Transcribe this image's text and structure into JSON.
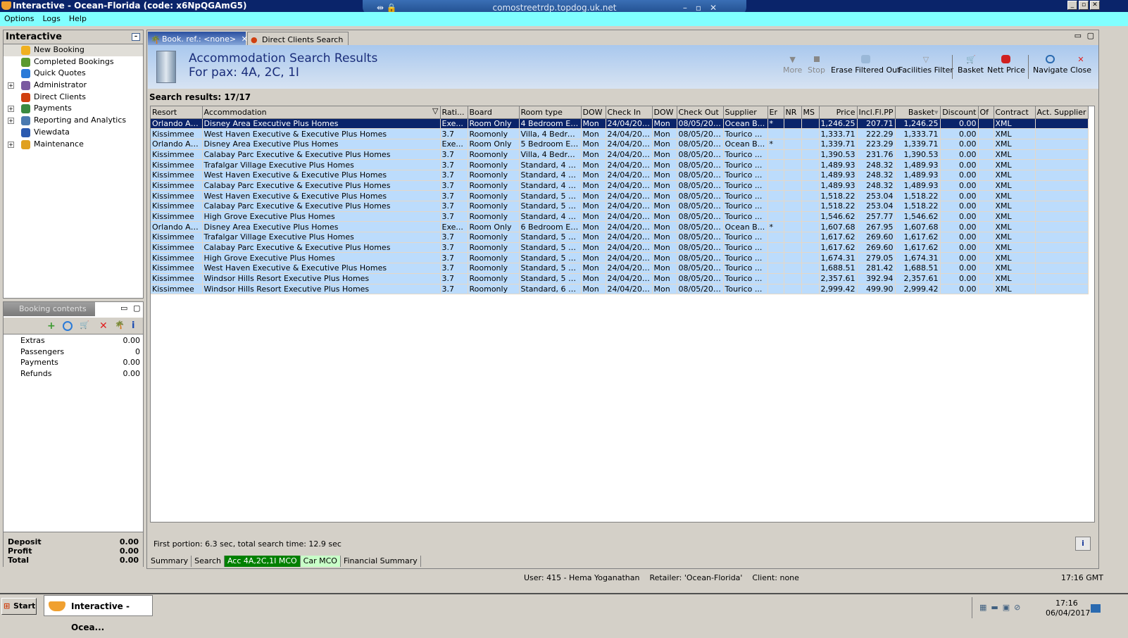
{
  "window": {
    "title": "Interactive - Ocean-Florida (code: x6NpQGAmG5)",
    "rdp_host": "comostreetrdp.topdog.uk.net"
  },
  "menu": [
    "Options",
    "Logs",
    "Help"
  ],
  "sidebar": {
    "title": "Interactive",
    "items": [
      {
        "label": "New Booking",
        "expandable": false,
        "icon": "palm-tree-icon"
      },
      {
        "label": "Completed Bookings",
        "expandable": false,
        "icon": "palm-money-icon"
      },
      {
        "label": "Quick Quotes",
        "expandable": false,
        "icon": "clock-icon"
      },
      {
        "label": "Administrator",
        "expandable": true,
        "icon": "admin-icon"
      },
      {
        "label": "Direct Clients",
        "expandable": false,
        "icon": "client-icon"
      },
      {
        "label": "Payments",
        "expandable": true,
        "icon": "payments-icon"
      },
      {
        "label": "Reporting and Analytics",
        "expandable": true,
        "icon": "report-icon"
      },
      {
        "label": "Viewdata",
        "expandable": false,
        "icon": "globe-icon"
      },
      {
        "label": "Maintenance",
        "expandable": true,
        "icon": "maintenance-icon"
      }
    ]
  },
  "booking_contents": {
    "tab": "Booking contents",
    "rows": [
      {
        "k": "Extras",
        "v": "0.00"
      },
      {
        "k": "Passengers",
        "v": "0"
      },
      {
        "k": "Payments",
        "v": "0.00"
      },
      {
        "k": "Refunds",
        "v": "0.00"
      }
    ],
    "totals": [
      {
        "k": "Deposit",
        "v": "0.00"
      },
      {
        "k": "Profit",
        "v": "0.00"
      },
      {
        "k": "Total",
        "v": "0.00"
      }
    ]
  },
  "tabs": [
    {
      "label": "Book. ref.: <none>",
      "active": true
    },
    {
      "label": "Direct Clients Search",
      "active": false
    }
  ],
  "header": {
    "title": "Accommodation Search Results",
    "subtitle": "For pax: 4A, 2C, 1I"
  },
  "toolbar": [
    {
      "label": "More",
      "enabled": false
    },
    {
      "label": "Stop",
      "enabled": false
    },
    {
      "label": "Erase Filtered Out",
      "enabled": true
    },
    {
      "label": "Facilities Filter",
      "enabled": true
    },
    {
      "label": "Basket",
      "enabled": true
    },
    {
      "label": "Nett Price",
      "enabled": true
    },
    {
      "label": "Navigate",
      "enabled": true
    },
    {
      "label": "Close",
      "enabled": true
    }
  ],
  "search_results": "Search results: 17/17",
  "columns": [
    "Resort",
    "Accommodation",
    "Rati...",
    "Board",
    "Room type",
    "DOW",
    "Check In",
    "DOW",
    "Check Out",
    "Supplier",
    "Er",
    "NR",
    "MS",
    "Price",
    "Incl.Fl.PP",
    "Basket",
    "Discount",
    "Of",
    "Contract",
    "Act. Supplier"
  ],
  "rows": [
    [
      "Orlando Ar...",
      "Disney Area Executive Plus Homes",
      "Exe...",
      "Room Only",
      "4 Bedroom Exe...",
      "Mon",
      "24/04/2017",
      "Mon",
      "08/05/2017",
      "Ocean B...",
      "*",
      "",
      "",
      "1,246.25",
      "207.71",
      "1,246.25",
      "0.00",
      "",
      "XML",
      ""
    ],
    [
      "Kissimmee",
      "West Haven Executive & Executive Plus Homes",
      "3.7",
      "Roomonly",
      "Villa, 4 Bedroo...",
      "Mon",
      "24/04/2017",
      "Mon",
      "08/05/2017",
      "Tourico ...",
      "",
      "",
      "",
      "1,333.71",
      "222.29",
      "1,333.71",
      "0.00",
      "",
      "XML",
      ""
    ],
    [
      "Orlando Ar...",
      "Disney Area Executive Plus Homes",
      "Exe...",
      "Room Only",
      "5 Bedroom Exe...",
      "Mon",
      "24/04/2017",
      "Mon",
      "08/05/2017",
      "Ocean B...",
      "*",
      "",
      "",
      "1,339.71",
      "223.29",
      "1,339.71",
      "0.00",
      "",
      "XML",
      ""
    ],
    [
      "Kissimmee",
      "Calabay Parc Executive & Executive Plus Homes",
      "3.7",
      "Roomonly",
      "Villa, 4 Bedroo...",
      "Mon",
      "24/04/2017",
      "Mon",
      "08/05/2017",
      "Tourico ...",
      "",
      "",
      "",
      "1,390.53",
      "231.76",
      "1,390.53",
      "0.00",
      "",
      "XML",
      ""
    ],
    [
      "Kissimmee",
      "Trafalgar Village Executive Plus Homes",
      "3.7",
      "Roomonly",
      "Standard, 4 Be...",
      "Mon",
      "24/04/2017",
      "Mon",
      "08/05/2017",
      "Tourico ...",
      "",
      "",
      "",
      "1,489.93",
      "248.32",
      "1,489.93",
      "0.00",
      "",
      "XML",
      ""
    ],
    [
      "Kissimmee",
      "West Haven Executive & Executive Plus Homes",
      "3.7",
      "Roomonly",
      "Standard, 4 Be...",
      "Mon",
      "24/04/2017",
      "Mon",
      "08/05/2017",
      "Tourico ...",
      "",
      "",
      "",
      "1,489.93",
      "248.32",
      "1,489.93",
      "0.00",
      "",
      "XML",
      ""
    ],
    [
      "Kissimmee",
      "Calabay Parc Executive & Executive Plus Homes",
      "3.7",
      "Roomonly",
      "Standard, 4 Be...",
      "Mon",
      "24/04/2017",
      "Mon",
      "08/05/2017",
      "Tourico ...",
      "",
      "",
      "",
      "1,489.93",
      "248.32",
      "1,489.93",
      "0.00",
      "",
      "XML",
      ""
    ],
    [
      "Kissimmee",
      "West Haven Executive & Executive Plus Homes",
      "3.7",
      "Roomonly",
      "Standard, 5 Be...",
      "Mon",
      "24/04/2017",
      "Mon",
      "08/05/2017",
      "Tourico ...",
      "",
      "",
      "",
      "1,518.22",
      "253.04",
      "1,518.22",
      "0.00",
      "",
      "XML",
      ""
    ],
    [
      "Kissimmee",
      "Calabay Parc Executive & Executive Plus Homes",
      "3.7",
      "Roomonly",
      "Standard, 5 Be...",
      "Mon",
      "24/04/2017",
      "Mon",
      "08/05/2017",
      "Tourico ...",
      "",
      "",
      "",
      "1,518.22",
      "253.04",
      "1,518.22",
      "0.00",
      "",
      "XML",
      ""
    ],
    [
      "Kissimmee",
      "High Grove Executive Plus Homes",
      "3.7",
      "Roomonly",
      "Standard, 4 Be...",
      "Mon",
      "24/04/2017",
      "Mon",
      "08/05/2017",
      "Tourico ...",
      "",
      "",
      "",
      "1,546.62",
      "257.77",
      "1,546.62",
      "0.00",
      "",
      "XML",
      ""
    ],
    [
      "Orlando Ar...",
      "Disney Area Executive Plus Homes",
      "Exe...",
      "Room Only",
      "6 Bedroom Exe...",
      "Mon",
      "24/04/2017",
      "Mon",
      "08/05/2017",
      "Ocean B...",
      "*",
      "",
      "",
      "1,607.68",
      "267.95",
      "1,607.68",
      "0.00",
      "",
      "XML",
      ""
    ],
    [
      "Kissimmee",
      "Trafalgar Village Executive Plus Homes",
      "3.7",
      "Roomonly",
      "Standard, 5 Be...",
      "Mon",
      "24/04/2017",
      "Mon",
      "08/05/2017",
      "Tourico ...",
      "",
      "",
      "",
      "1,617.62",
      "269.60",
      "1,617.62",
      "0.00",
      "",
      "XML",
      ""
    ],
    [
      "Kissimmee",
      "Calabay Parc Executive & Executive Plus Homes",
      "3.7",
      "Roomonly",
      "Standard, 5 Be...",
      "Mon",
      "24/04/2017",
      "Mon",
      "08/05/2017",
      "Tourico ...",
      "",
      "",
      "",
      "1,617.62",
      "269.60",
      "1,617.62",
      "0.00",
      "",
      "XML",
      ""
    ],
    [
      "Kissimmee",
      "High Grove Executive Plus Homes",
      "3.7",
      "Roomonly",
      "Standard, 5 Be...",
      "Mon",
      "24/04/2017",
      "Mon",
      "08/05/2017",
      "Tourico ...",
      "",
      "",
      "",
      "1,674.31",
      "279.05",
      "1,674.31",
      "0.00",
      "",
      "XML",
      ""
    ],
    [
      "Kissimmee",
      "West Haven Executive & Executive Plus Homes",
      "3.7",
      "Roomonly",
      "Standard, 5 Be...",
      "Mon",
      "24/04/2017",
      "Mon",
      "08/05/2017",
      "Tourico ...",
      "",
      "",
      "",
      "1,688.51",
      "281.42",
      "1,688.51",
      "0.00",
      "",
      "XML",
      ""
    ],
    [
      "Kissimmee",
      "Windsor Hills Resort Executive Plus Homes",
      "3.7",
      "Roomonly",
      "Standard, 5 Be...",
      "Mon",
      "24/04/2017",
      "Mon",
      "08/05/2017",
      "Tourico ...",
      "",
      "",
      "",
      "2,357.61",
      "392.94",
      "2,357.61",
      "0.00",
      "",
      "XML",
      ""
    ],
    [
      "Kissimmee",
      "Windsor Hills Resort Executive Plus Homes",
      "3.7",
      "Roomonly",
      "Standard, 6 Be...",
      "Mon",
      "24/04/2017",
      "Mon",
      "08/05/2017",
      "Tourico ...",
      "",
      "",
      "",
      "2,999.42",
      "499.90",
      "2,999.42",
      "0.00",
      "",
      "XML",
      ""
    ]
  ],
  "search_time": "First portion: 6.3 sec, total search time: 12.9 sec",
  "bottom_tabs": [
    {
      "label": "Summary",
      "bg": "#d4d0c8",
      "fg": "#000000"
    },
    {
      "label": "Search",
      "bg": "#d4d0c8",
      "fg": "#000000"
    },
    {
      "label": "Acc 4A,2C,1I MCO",
      "bg": "#008000",
      "fg": "#ffffff"
    },
    {
      "label": "Car MCO",
      "bg": "#c8ffc8",
      "fg": "#000000"
    },
    {
      "label": "Financial Summary",
      "bg": "#d4d0c8",
      "fg": "#000000"
    }
  ],
  "status": {
    "user": "User: 415 - Hema Yoganathan    Retailer: 'Ocean-Florida'    Client: none",
    "time": "17:16 GMT"
  },
  "taskbar": {
    "start": "Start",
    "task": "Interactive - Ocea...",
    "clock_time": "17:16",
    "clock_date": "06/04/2017"
  }
}
